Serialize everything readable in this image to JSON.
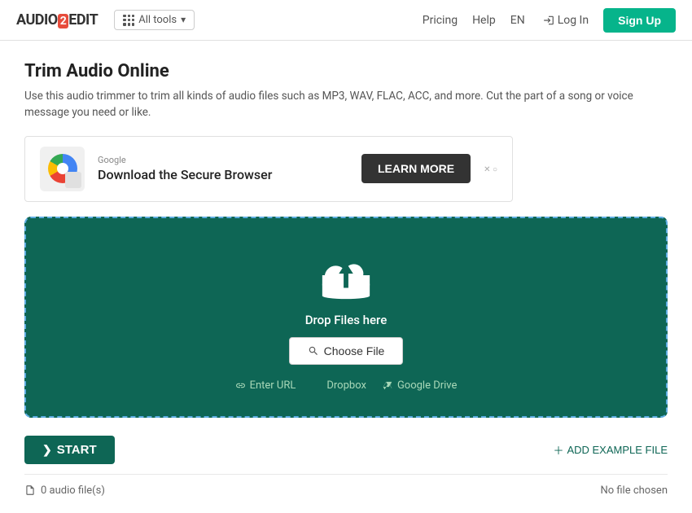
{
  "brand": {
    "name_pre": "AUDIO",
    "num": "2",
    "name_post": "EDIT"
  },
  "nav": {
    "all_tools": "All tools",
    "pricing": "Pricing",
    "help": "Help",
    "lang": "EN",
    "login": "Log In",
    "signup": "Sign Up"
  },
  "page": {
    "title": "Trim Audio Online",
    "description": "Use this audio trimmer to trim all kinds of audio files such as MP3, WAV, FLAC, ACC, and more. Cut the part of a song or voice message you need or like."
  },
  "ad": {
    "source": "Google",
    "headline": "Download the Secure Browser",
    "cta": "LEARN MORE",
    "footer": "✕ ○"
  },
  "dropzone": {
    "drop_text": "Drop Files here",
    "choose_label": "Choose File",
    "enter_url": "Enter URL",
    "dropbox": "Dropbox",
    "google_drive": "Google Drive"
  },
  "actions": {
    "start": "START",
    "add_example": "ADD EXAMPLE FILE"
  },
  "bottom": {
    "left_icon": "file-icon",
    "left_text": "0 audio file(s)",
    "right_text": "No file chosen"
  }
}
